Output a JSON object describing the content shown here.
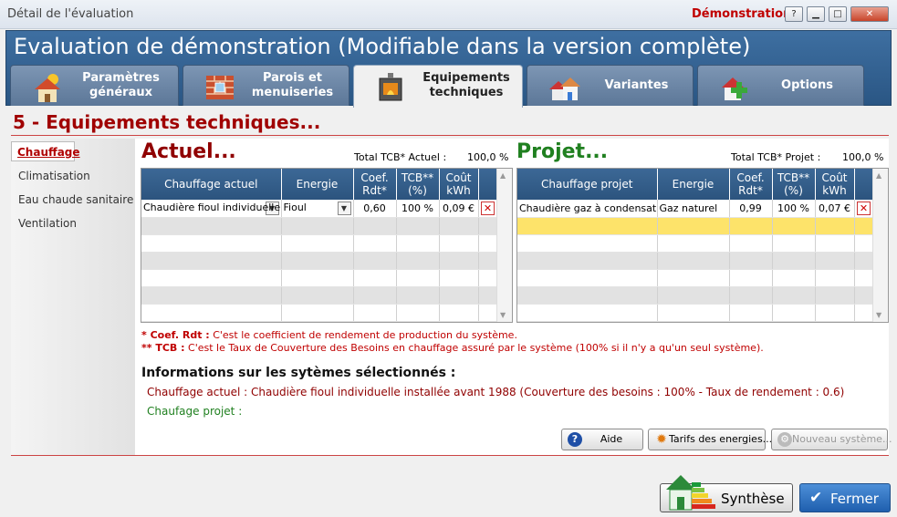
{
  "window": {
    "title": "Détail de l'évaluation",
    "badge": "Démonstration",
    "btn_help": "?",
    "btn_min": "▁",
    "btn_max": "□",
    "btn_close": "✕"
  },
  "header": {
    "title": "Evaluation de démonstration (Modifiable dans la version complète)"
  },
  "tabs": [
    {
      "label": "Paramètres généraux"
    },
    {
      "label": "Parois et menuiseries"
    },
    {
      "label": "Equipements techniques"
    },
    {
      "label": "Variantes"
    },
    {
      "label": "Options"
    }
  ],
  "section_title": "5 - Equipements techniques...",
  "sidebar": {
    "items": [
      "Chauffage",
      "Climatisation",
      "Eau chaude sanitaire",
      "Ventilation"
    ]
  },
  "actuel": {
    "heading": "Actuel...",
    "total_label": "Total TCB* Actuel :",
    "total_value": "100,0 %",
    "columns": [
      "Chauffage actuel",
      "Energie",
      "Coef. Rdt*",
      "TCB** (%)",
      "Coût kWh"
    ],
    "rows": [
      {
        "system": "Chaudière fioul individuelle in",
        "energy": "Fioul",
        "coef": "0,60",
        "tcb": "100 %",
        "cost": "0,09 €"
      }
    ]
  },
  "projet": {
    "heading": "Projet...",
    "total_label": "Total TCB* Projet :",
    "total_value": "100,0 %",
    "columns": [
      "Chauffage projet",
      "Energie",
      "Coef. Rdt*",
      "TCB** (%)",
      "Coût kWh"
    ],
    "rows": [
      {
        "system": "Chaudière gaz à condensation",
        "energy": "Gaz naturel",
        "coef": "0,99",
        "tcb": "100 %",
        "cost": "0,07 €"
      }
    ]
  },
  "notes": {
    "coef_key": "* Coef. Rdt :",
    "coef_text": "C'est le coefficient de rendement de production du système.",
    "tcb_key": "** TCB :",
    "tcb_text": "C'est le Taux de Couverture des Besoins en chauffage assuré par le système (100% si il n'y a qu'un seul système)."
  },
  "info": {
    "title": "Informations sur les sytèmes sélectionnés :",
    "actuel_line": "Chauffage actuel : Chaudière fioul individuelle installée avant 1988 (Couverture des besoins : 100% - Taux de rendement : 0.6)",
    "projet_line": "Chaufage projet :"
  },
  "buttons": {
    "aide": "Aide",
    "tarifs": "Tarifs des energies...",
    "nouveau": "Nouveau système...",
    "synthese": "Synthèse",
    "fermer": "Fermer"
  },
  "colors": {
    "accent_red": "#a00000",
    "accent_green": "#208020",
    "header_blue": "#2a5684",
    "highlight_row": "#fde36a"
  }
}
